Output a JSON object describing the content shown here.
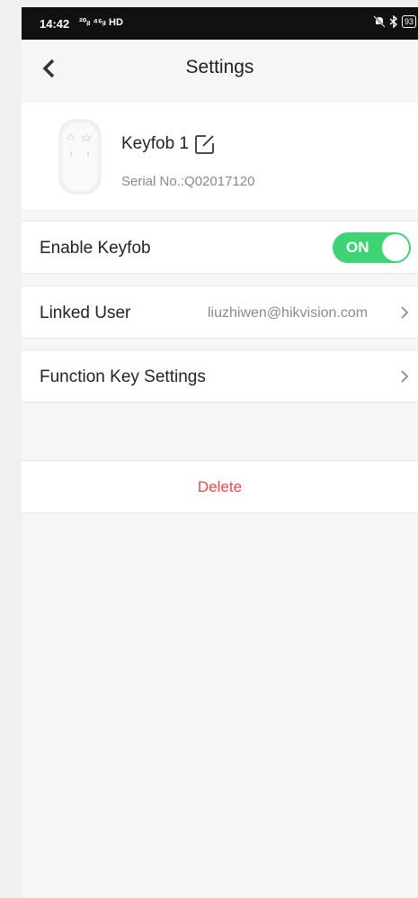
{
  "status_bar": {
    "time": "14:42",
    "network": "²⁰ᵢₗ ⁴⁶ᵢₗ HD",
    "battery": "93"
  },
  "header": {
    "title": "Settings",
    "back_icon": "chevron-left-icon"
  },
  "device": {
    "name": "Keyfob 1",
    "serial": "Serial No.:Q02017120",
    "edit_icon": "edit-icon"
  },
  "settings": {
    "enable_keyfob": {
      "label": "Enable Keyfob",
      "toggle_text": "ON",
      "enabled": true
    },
    "linked_user": {
      "label": "Linked User",
      "value": "liuzhiwen@hikvision.com"
    },
    "function_key": {
      "label": "Function Key Settings"
    }
  },
  "actions": {
    "delete_label": "Delete"
  },
  "colors": {
    "toggle_on": "#3ed476",
    "delete": "#e8484c"
  }
}
